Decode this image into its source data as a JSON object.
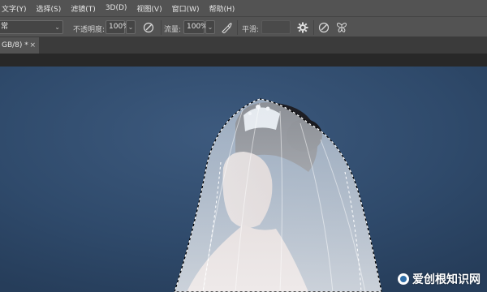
{
  "menu": {
    "items": [
      "文字(Y)",
      "选择(S)",
      "滤镜(T)",
      "3D(D)",
      "视图(V)",
      "窗口(W)",
      "帮助(H)"
    ]
  },
  "options": {
    "mode_select": "常",
    "opacity_label": "不透明度:",
    "opacity_value": "100%",
    "flow_label": "流量:",
    "flow_value": "100%",
    "smoothing_label": "平滑:",
    "smoothing_value": "",
    "icons": [
      "pressure-opacity-icon",
      "airbrush-icon",
      "gear-icon",
      "pressure-size-icon",
      "butterfly-symmetry-icon"
    ]
  },
  "document": {
    "tab_label": "GB/8) *",
    "close_glyph": "×"
  },
  "watermark": {
    "text": "爱创根知识网"
  },
  "colors": {
    "chrome": "#535353",
    "canvas_bg": "#2f4a6b"
  }
}
